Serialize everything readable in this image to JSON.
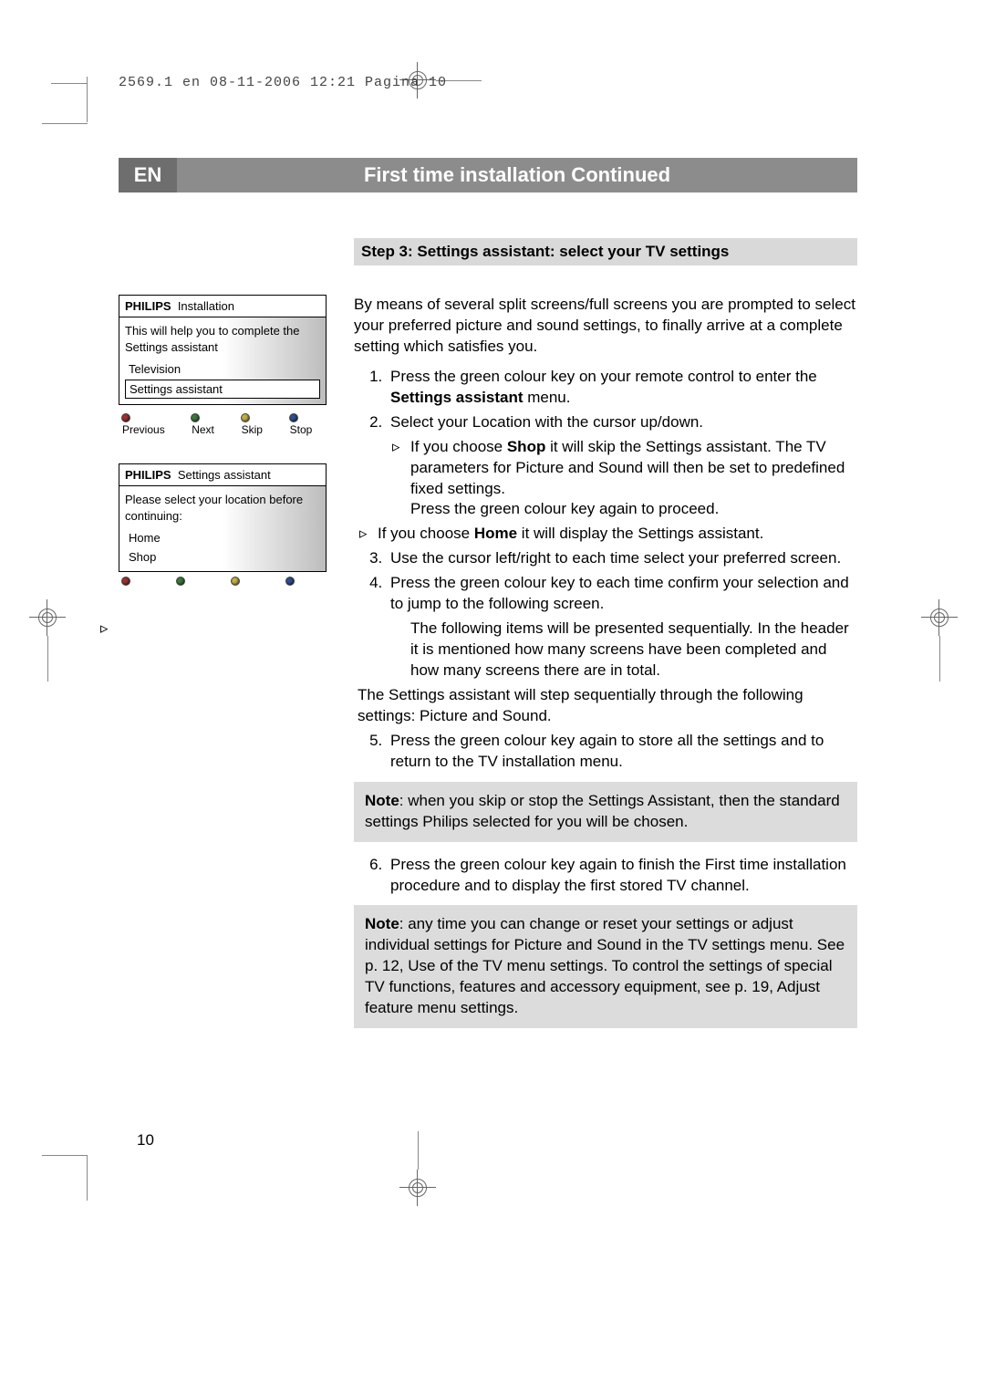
{
  "header_line": "2569.1 en  08-11-2006  12:21  Pagina 10",
  "lang_code": "EN",
  "title": "First time installation  Continued",
  "step_heading": "Step 3: Settings assistant: select your TV settings",
  "osd1": {
    "brand": "PHILIPS",
    "title": "Installation",
    "text": "This will help you to complete the Settings assistant",
    "item1": "Television",
    "item2": "Settings assistant",
    "legend": {
      "red": "Previous",
      "green": "Next",
      "yellow": "Skip",
      "blue": "Stop"
    }
  },
  "osd2": {
    "brand": "PHILIPS",
    "title": "Settings assistant",
    "text": "Please select your location before continuing:",
    "item1": "Home",
    "item2": "Shop"
  },
  "intro": "By means of several split screens/full screens you are prompted to select your preferred picture and sound settings, to finally arrive at a complete setting which satisfies you.",
  "steps": {
    "s1a": "Press the green colour key on your remote control to enter the ",
    "s1b": "Settings assistant",
    "s1c": " menu.",
    "s2": "Select your Location with the cursor up/down.",
    "s2_shop_a": "If you choose ",
    "s2_shop_b": "Shop",
    "s2_shop_c": " it will skip the Settings assistant. The TV parameters for Picture and Sound will then be set to predefined fixed settings.",
    "s2_press": "Press the green colour key again to proceed.",
    "s2_home_a": "If you choose ",
    "s2_home_b": "Home",
    "s2_home_c": " it will display the Settings assistant.",
    "s3": "Use the cursor left/right to each time select your preferred screen.",
    "s4": "Press the green colour key to each time confirm your selection and to jump to the following screen.",
    "s4_sub": "The following items will be presented sequentially. In the header it is mentioned how many screens have been completed and how many screens there are in total.",
    "s4_after": "The Settings assistant will step sequentially through the following settings: Picture and Sound.",
    "s5": "Press the green colour key again to store all the settings and to return to the TV installation menu.",
    "s6": "Press the green colour key again to finish the First time installation procedure and to display the first stored TV channel."
  },
  "note1_label": "Note",
  "note1_text": ": when you skip or stop the Settings Assistant, then the standard settings Philips selected for you will be chosen.",
  "note2_label": "Note",
  "note2_text": ": any time you can change or reset your settings or adjust individual settings for Picture and Sound in the TV settings menu. See p. 12, Use of the TV menu settings. To control the settings of special TV functions, features and accessory equipment, see p. 19,  Adjust feature menu settings.",
  "page_number": "10"
}
